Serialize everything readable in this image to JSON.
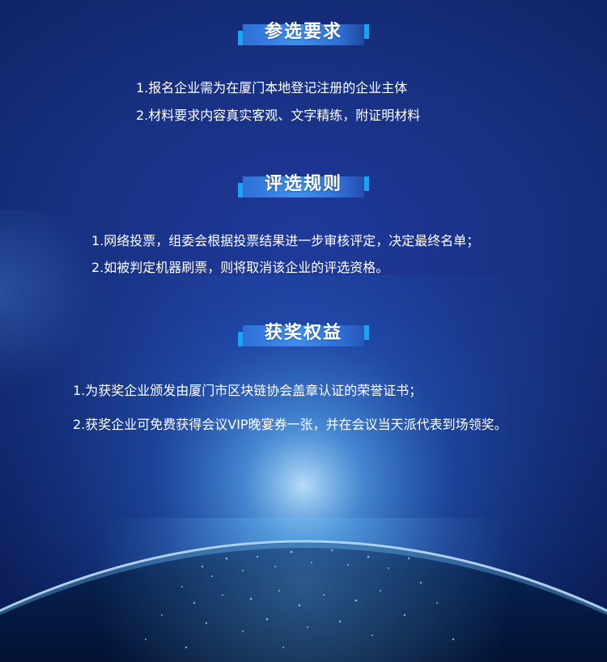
{
  "sections": [
    {
      "title": "参选要求",
      "items": [
        "1.报名企业需为在厦门本地登记注册的企业主体",
        "2.材料要求内容真实客观、文字精练，附证明材料"
      ]
    },
    {
      "title": "评选规则",
      "items": [
        "1.网络投票，组委会根据投票结果进一步审核评定，决定最终名单；",
        "2.如被判定机器刷票，则将取消该企业的评选资格。"
      ]
    },
    {
      "title": "获奖权益",
      "items": [
        "1.为获奖企业颁发由厦门市区块链协会盖章认证的荣誉证书；",
        "2.获奖企业可免费获得会议VIP晚宴券一张，并在会议当天派代表到场领奖。"
      ]
    }
  ],
  "colors": {
    "background": "#17307f",
    "title_bar": "#3e8ff0",
    "title_accent": "#19a4f5",
    "text": "#ffffff"
  }
}
